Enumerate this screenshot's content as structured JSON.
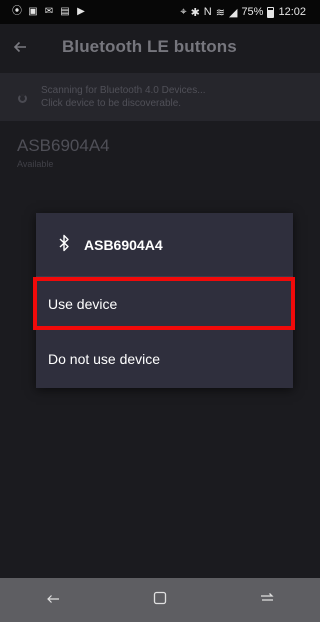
{
  "status_bar": {
    "battery_percent": "75%",
    "time": "12:02",
    "left_icons": [
      "circle-icon",
      "image-icon",
      "mail-icon",
      "screenshot-icon",
      "play-icon"
    ],
    "right_icons": [
      "location-icon",
      "bluetooth-icon",
      "nfc-icon",
      "wifi-icon",
      "signal-icon",
      "battery-icon"
    ]
  },
  "app_bar": {
    "title": "Bluetooth LE buttons",
    "back_icon": "arrow-left-icon"
  },
  "scan_banner": {
    "line1": "Scanning for Bluetooth 4.0 Devices...",
    "line2": "Click device to be discoverable."
  },
  "device": {
    "name": "ASB6904A4",
    "status": "Available"
  },
  "dialog": {
    "title": "ASB6904A4",
    "icon": "bluetooth-icon",
    "options": [
      {
        "label": "Use device"
      },
      {
        "label": "Do not use device"
      }
    ]
  },
  "highlight_color": "#f10a0a",
  "nav_bar": {
    "icons": [
      "back-icon",
      "home-icon",
      "recents-icon"
    ]
  }
}
